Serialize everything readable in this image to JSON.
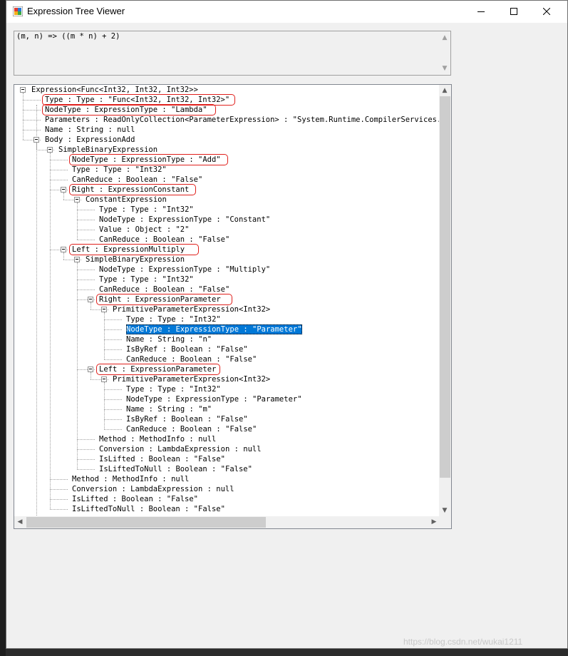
{
  "window": {
    "title": "Expression Tree Viewer",
    "title_bar_bg": "#ffffff",
    "buttons": {
      "minimize_icon": "minimize-icon",
      "maximize_icon": "maximize-icon",
      "close_icon": "close-icon"
    }
  },
  "expression_box": {
    "text": "(m, n) => ((m * n) + 2)"
  },
  "tree": {
    "colors": {
      "highlight": "#e0201c",
      "selection": "#0078d7"
    },
    "nodes": [
      {
        "text": "Expression<Func<Int32, Int32, Int32>>"
      },
      {
        "text": "Type : Type : \"Func<Int32, Int32, Int32>\""
      },
      {
        "text": "NodeType : ExpressionType : \"Lambda\""
      },
      {
        "text": "Parameters : ReadOnlyCollection<ParameterExpression> : \"System.Runtime.CompilerServices.True"
      },
      {
        "text": "Name : String : null"
      },
      {
        "text": "Body : ExpressionAdd"
      },
      {
        "text": "SimpleBinaryExpression"
      },
      {
        "text": "NodeType : ExpressionType : \"Add\""
      },
      {
        "text": "Type : Type : \"Int32\""
      },
      {
        "text": "CanReduce : Boolean : \"False\""
      },
      {
        "text": "Right : ExpressionConstant"
      },
      {
        "text": "ConstantExpression"
      },
      {
        "text": "Type : Type : \"Int32\""
      },
      {
        "text": "NodeType : ExpressionType : \"Constant\""
      },
      {
        "text": "Value : Object : \"2\""
      },
      {
        "text": "CanReduce : Boolean : \"False\""
      },
      {
        "text": "Left : ExpressionMultiply"
      },
      {
        "text": "SimpleBinaryExpression"
      },
      {
        "text": "NodeType : ExpressionType : \"Multiply\""
      },
      {
        "text": "Type : Type : \"Int32\""
      },
      {
        "text": "CanReduce : Boolean : \"False\""
      },
      {
        "text": "Right : ExpressionParameter"
      },
      {
        "text": "PrimitiveParameterExpression<Int32>"
      },
      {
        "text": "Type : Type : \"Int32\""
      },
      {
        "text": "NodeType : ExpressionType : \"Parameter\""
      },
      {
        "text": "Name : String : \"n\""
      },
      {
        "text": "IsByRef : Boolean : \"False\""
      },
      {
        "text": "CanReduce : Boolean : \"False\""
      },
      {
        "text": "Left : ExpressionParameter"
      },
      {
        "text": "PrimitiveParameterExpression<Int32>"
      },
      {
        "text": "Type : Type : \"Int32\""
      },
      {
        "text": "NodeType : ExpressionType : \"Parameter\""
      },
      {
        "text": "Name : String : \"m\""
      },
      {
        "text": "IsByRef : Boolean : \"False\""
      },
      {
        "text": "CanReduce : Boolean : \"False\""
      },
      {
        "text": "Method : MethodInfo : null"
      },
      {
        "text": "Conversion : LambdaExpression : null"
      },
      {
        "text": "IsLifted : Boolean : \"False\""
      },
      {
        "text": "IsLiftedToNull : Boolean : \"False\""
      },
      {
        "text": "Method : MethodInfo : null"
      },
      {
        "text": "Conversion : LambdaExpression : null"
      },
      {
        "text": "IsLifted : Boolean : \"False\""
      },
      {
        "text": "IsLiftedToNull : Boolean : \"False\""
      }
    ]
  },
  "watermark": "https://blog.csdn.net/wukai1211"
}
